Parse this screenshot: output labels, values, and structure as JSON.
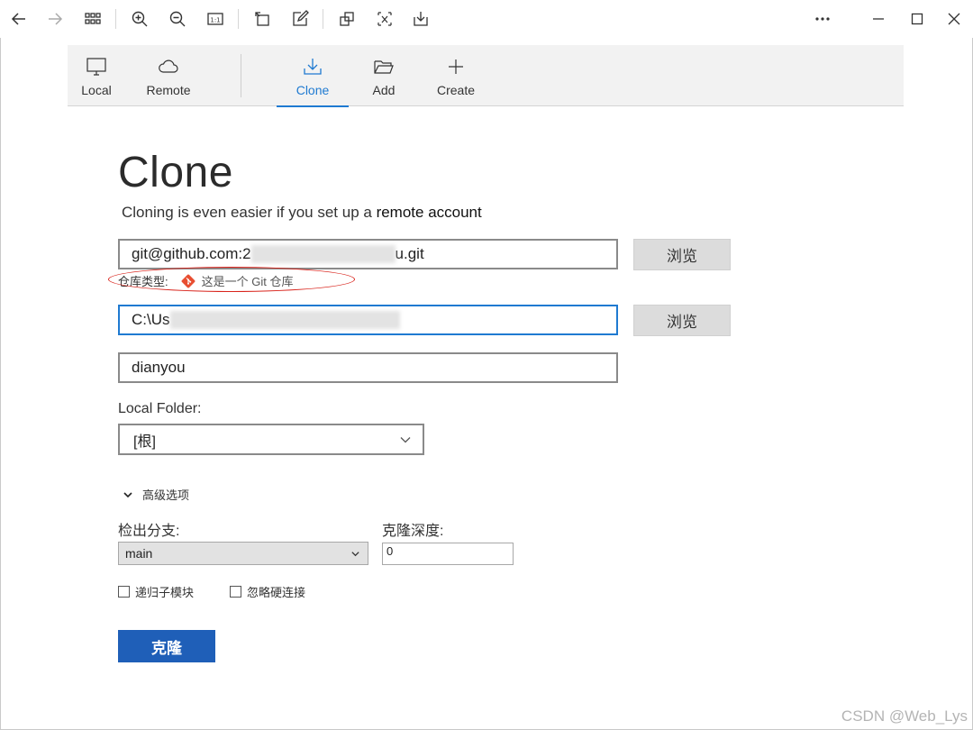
{
  "viewer_toolbar": {
    "icons": [
      "back-icon",
      "forward-icon",
      "grid-icon",
      "zoom-in-icon",
      "zoom-out-icon",
      "actual-size-icon",
      "rotate-icon",
      "edit-icon",
      "crop-icon",
      "translate-icon",
      "download-icon",
      "more-icon",
      "minimize-icon",
      "maximize-icon",
      "close-icon"
    ],
    "actual_size_label": "1:1"
  },
  "nav": {
    "items": [
      {
        "label": "Local",
        "icon": "monitor-icon"
      },
      {
        "label": "Remote",
        "icon": "cloud-icon"
      },
      {
        "label": "Clone",
        "icon": "download-tray-icon",
        "active": true
      },
      {
        "label": "Add",
        "icon": "folder-open-icon"
      },
      {
        "label": "Create",
        "icon": "plus-icon"
      }
    ],
    "accent": "#1f7ad1"
  },
  "page": {
    "title": "Clone",
    "subtitle_prefix": "Cloning is even easier if you set up a ",
    "subtitle_link": "remote account"
  },
  "form": {
    "source_url_prefix": "git@github.com:2",
    "source_url_suffix": "u.git",
    "browse_label": "浏览",
    "repo_type_label": "仓库类型:",
    "repo_type_value": "这是一个 Git 仓库",
    "dest_path_prefix": "C:\\Us",
    "name_value": "dianyou",
    "local_folder_label": "Local Folder:",
    "local_folder_value": "[根]",
    "advanced_label": "高级选项",
    "branch_label": "检出分支:",
    "branch_value": "main",
    "depth_label": "克隆深度:",
    "depth_value": "0",
    "recurse_label": "递归子模块",
    "ignore_hardlinks_label": "忽略硬连接",
    "clone_button": "克隆"
  },
  "colors": {
    "primary_button": "#1f5fb8",
    "highlight_ellipse": "#d9241c"
  },
  "watermark": "CSDN @Web_Lys"
}
